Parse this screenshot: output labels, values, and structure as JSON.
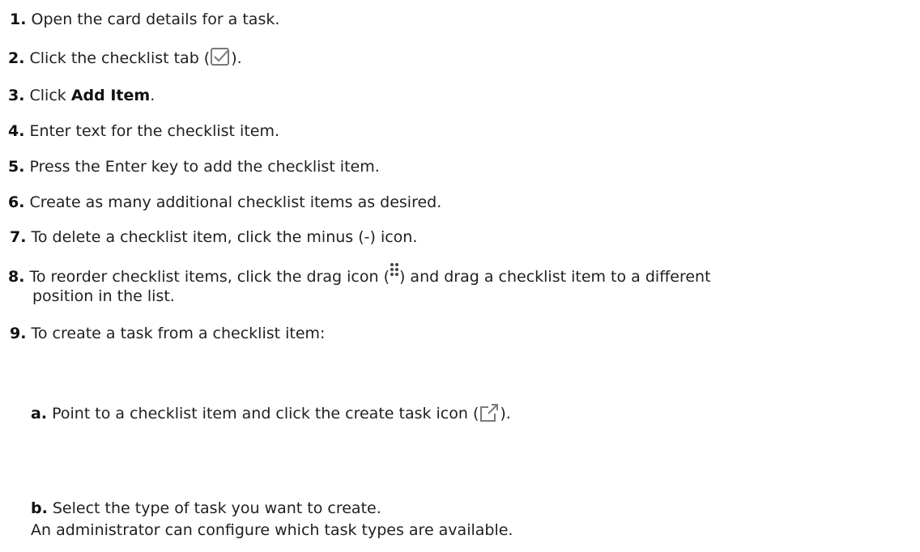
{
  "steps": [
    {
      "num": "1.",
      "text": "Open the card details for a task."
    },
    {
      "num": "2.",
      "before": "Click the checklist tab (",
      "icon": "checkbox-checked-icon",
      "after": ")."
    },
    {
      "num": "3.",
      "before": "Click ",
      "bold": "Add Item",
      "after": "."
    },
    {
      "num": "4.",
      "text": "Enter text for the checklist item."
    },
    {
      "num": "5.",
      "text": "Press the Enter key to add the checklist item."
    },
    {
      "num": "6.",
      "text": "Create as many additional checklist items as desired."
    },
    {
      "num": "7.",
      "text": "To delete a checklist item, click the minus (-) icon."
    },
    {
      "num": "8.",
      "before": "To reorder checklist items, click the drag icon (",
      "icon": "drag-dots-icon",
      "after": ") and drag a checklist item to a different",
      "line2": "position in the list."
    },
    {
      "num": "9.",
      "text": "To create a task from a checklist item:"
    }
  ],
  "substeps": [
    {
      "num": "a.",
      "before": "Point to a checklist item and click the create task icon (",
      "icon": "external-link-icon",
      "after": ")."
    },
    {
      "num": "b.",
      "text": "Select the type of task you want to create.",
      "line2": "An administrator can configure which task types are available."
    }
  ],
  "colors": {
    "text": "#1f1f1f",
    "icon": "#7a7a7a"
  }
}
